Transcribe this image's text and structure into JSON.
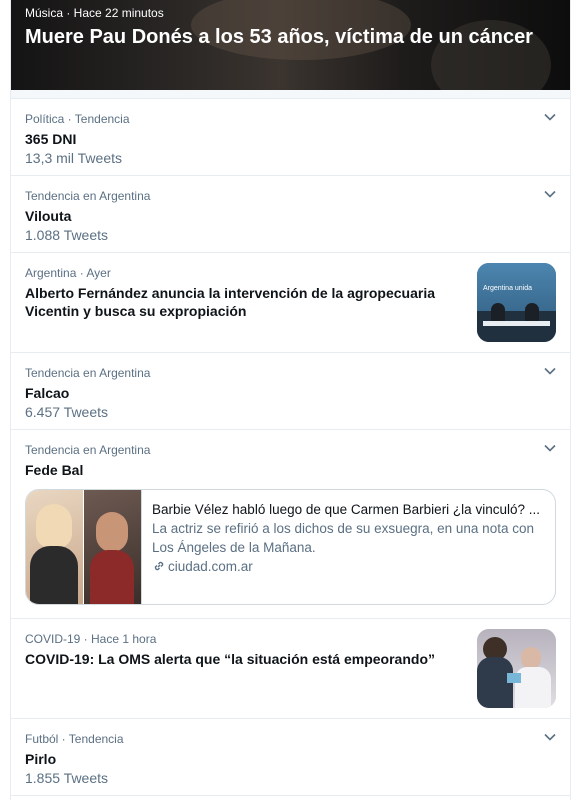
{
  "hero": {
    "meta": "Música · Hace 22 minutos",
    "title": "Muere Pau Donés a los 53 años, víctima de un cáncer"
  },
  "trends": [
    {
      "meta": "Política · Tendencia",
      "title": "365 DNI",
      "count": "13,3 mil Tweets"
    },
    {
      "meta": "Tendencia en Argentina",
      "title": "Vilouta",
      "count": "1.088 Tweets"
    },
    {
      "meta": "Argentina · Ayer",
      "title": "Alberto Fernández anuncia la intervención de la agropecuaria Vicentin y busca su expropiación",
      "thumb_caption": "Argentina unida"
    },
    {
      "meta": "Tendencia en Argentina",
      "title": "Falcao",
      "count": "6.457 Tweets"
    },
    {
      "meta": "Tendencia en Argentina",
      "title": "Fede Bal",
      "card": {
        "title": "Barbie Vélez habló luego de que Carmen Barbieri ¿la vinculó? ...",
        "description": "La actriz se refirió a los dichos de su exsuegra, en una nota con Los Ángeles de la Mañana.",
        "domain": "ciudad.com.ar"
      }
    },
    {
      "meta": "COVID-19 · Hace 1 hora",
      "title": "COVID-19: La OMS alerta que “la situación está empeorando”"
    },
    {
      "meta": "Futból · Tendencia",
      "title": "Pirlo",
      "count": "1.855 Tweets"
    }
  ],
  "colors": {
    "accent": "#1da1f2",
    "secondary_text": "#5b7083",
    "border": "#e6ecf0"
  },
  "icons": {
    "more": "chevron-down-icon",
    "link": "link-icon"
  }
}
